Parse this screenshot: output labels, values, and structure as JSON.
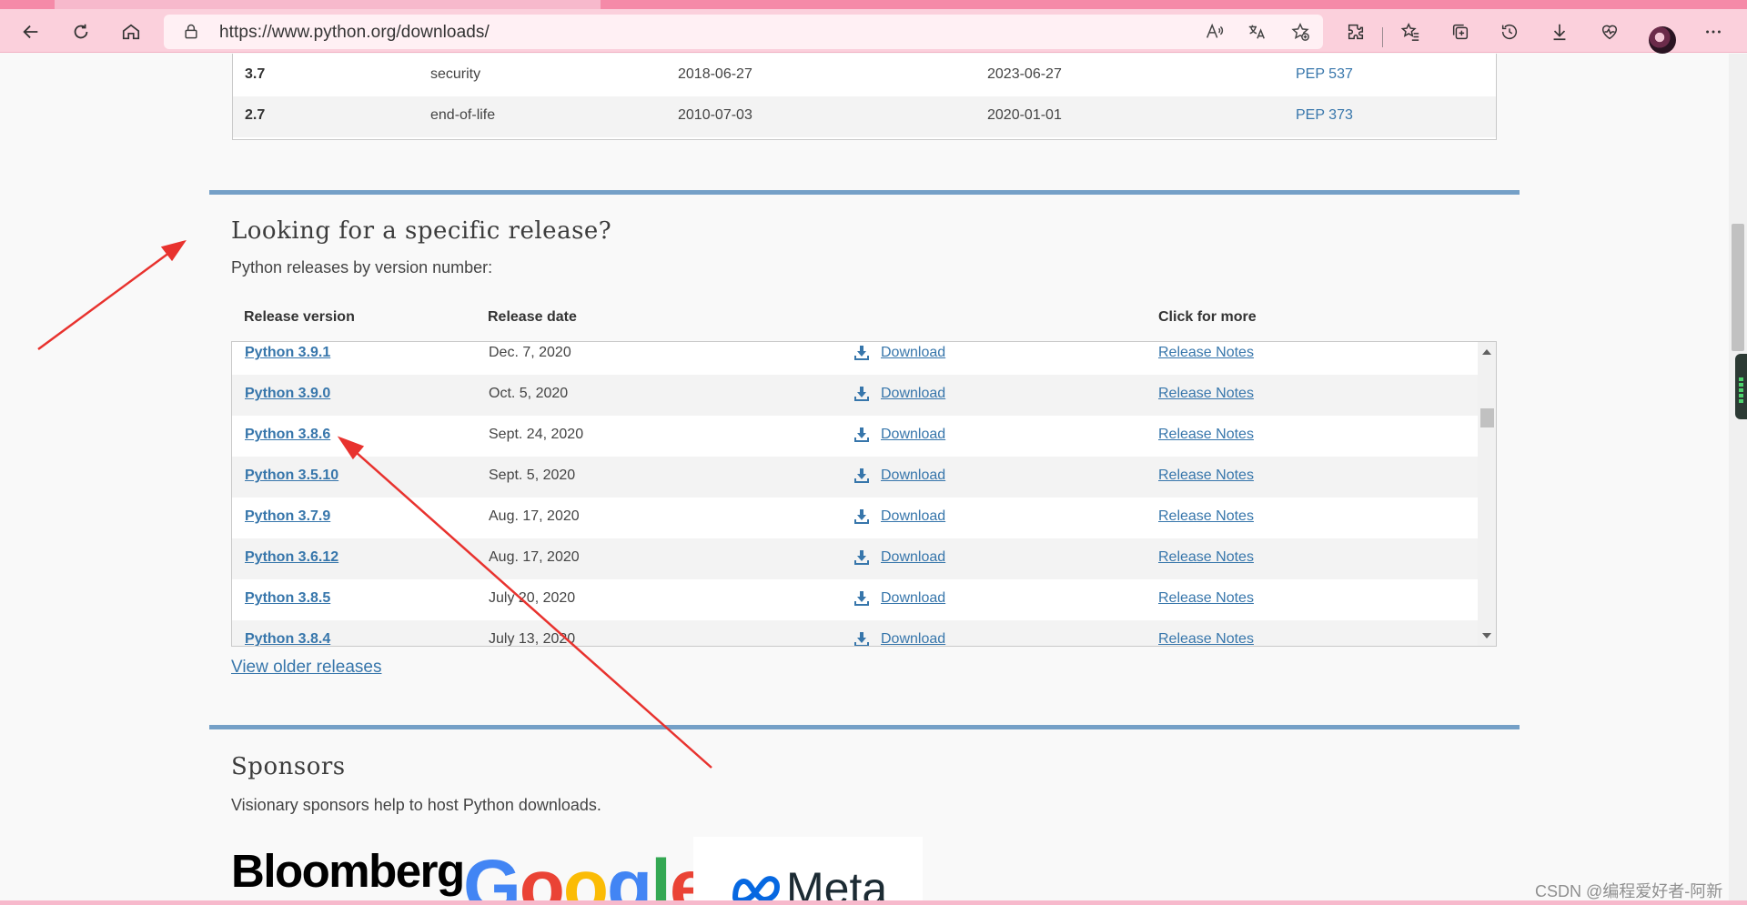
{
  "browser": {
    "url": "https://www.python.org/downloads/"
  },
  "summary_rows": [
    {
      "version": "3.7",
      "status": "security",
      "released": "2018-06-27",
      "end_of_support": "2023-06-27",
      "pep": "PEP 537"
    },
    {
      "version": "2.7",
      "status": "end-of-life",
      "released": "2010-07-03",
      "end_of_support": "2020-01-01",
      "pep": "PEP 373"
    }
  ],
  "specific_release": {
    "heading": "Looking for a specific release?",
    "subtitle": "Python releases by version number:",
    "columns": {
      "version": "Release version",
      "date": "Release date",
      "more": "Click for more"
    },
    "releases": [
      {
        "name": "Python 3.9.1",
        "date": "Dec. 7, 2020",
        "download": "Download",
        "notes": "Release Notes"
      },
      {
        "name": "Python 3.9.0",
        "date": "Oct. 5, 2020",
        "download": "Download",
        "notes": "Release Notes"
      },
      {
        "name": "Python 3.8.6",
        "date": "Sept. 24, 2020",
        "download": "Download",
        "notes": "Release Notes"
      },
      {
        "name": "Python 3.5.10",
        "date": "Sept. 5, 2020",
        "download": "Download",
        "notes": "Release Notes"
      },
      {
        "name": "Python 3.7.9",
        "date": "Aug. 17, 2020",
        "download": "Download",
        "notes": "Release Notes"
      },
      {
        "name": "Python 3.6.12",
        "date": "Aug. 17, 2020",
        "download": "Download",
        "notes": "Release Notes"
      },
      {
        "name": "Python 3.8.5",
        "date": "July 20, 2020",
        "download": "Download",
        "notes": "Release Notes"
      },
      {
        "name": "Python 3.8.4",
        "date": "July 13, 2020",
        "download": "Download",
        "notes": "Release Notes"
      }
    ],
    "older_link": "View older releases"
  },
  "sponsors": {
    "heading": "Sponsors",
    "subtitle": "Visionary sponsors help to host Python downloads.",
    "logos": [
      "Bloomberg",
      "Google",
      "Meta"
    ]
  },
  "watermark": "CSDN @编程爱好者-阿新",
  "colors": {
    "link": "#3776ab",
    "divider": "#75a0c7",
    "chrome": "#fbd0dc",
    "annotation_arrow": "#e8322e"
  }
}
